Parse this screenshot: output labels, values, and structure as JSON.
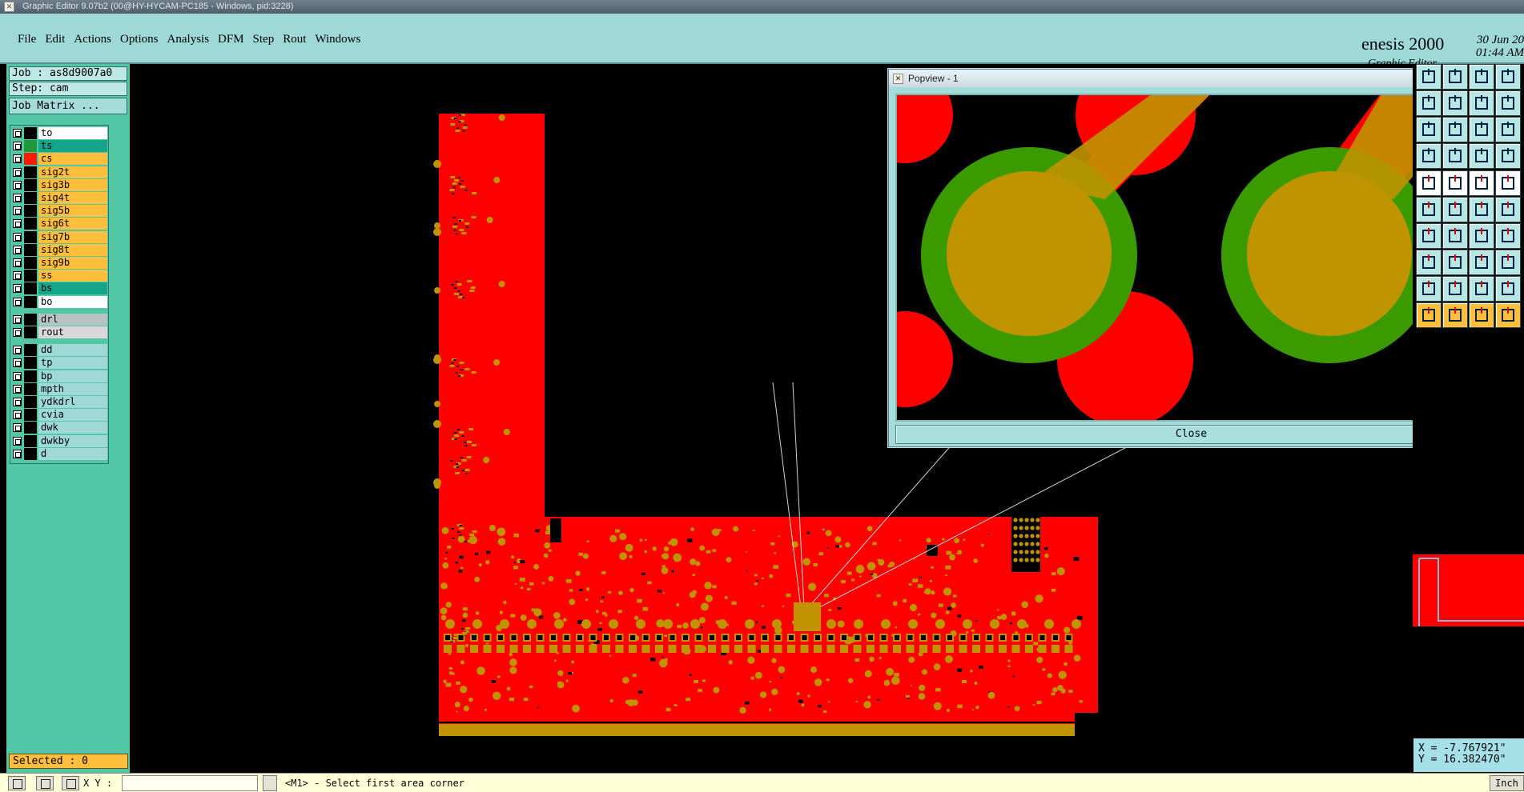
{
  "window": {
    "title": "Graphic Editor 9.07b2 (00@HY-HYCAM-PC185 - Windows, pid:3228)"
  },
  "menu": {
    "items": [
      "File",
      "Edit",
      "Actions",
      "Options",
      "Analysis",
      "DFM",
      "Step",
      "Rout",
      "Windows"
    ]
  },
  "brand": {
    "name": "enesis 2000",
    "subtitle": "Graphic Editor",
    "date": "30 Jun 20",
    "time": "01:44 AM"
  },
  "job": {
    "label": "Job : as8d9007a0",
    "step": "Step: cam",
    "matrix_button": "Job Matrix ..."
  },
  "layers": [
    {
      "name": "to",
      "swatch": "#000000",
      "bg": "#ffffff"
    },
    {
      "name": "ts",
      "swatch": "#1f9a3a",
      "bg": "#15a58b"
    },
    {
      "name": "cs",
      "swatch": "#ff1a00",
      "bg": "#ffbf3c"
    },
    {
      "name": "sig2t",
      "swatch": "#000000",
      "bg": "#ffbf3c"
    },
    {
      "name": "sig3b",
      "swatch": "#000000",
      "bg": "#ffbf3c"
    },
    {
      "name": "sig4t",
      "swatch": "#000000",
      "bg": "#ffbf3c"
    },
    {
      "name": "sig5b",
      "swatch": "#000000",
      "bg": "#ffbf3c"
    },
    {
      "name": "sig6t",
      "swatch": "#000000",
      "bg": "#ffbf3c"
    },
    {
      "name": "sig7b",
      "swatch": "#000000",
      "bg": "#ffbf3c"
    },
    {
      "name": "sig8t",
      "swatch": "#000000",
      "bg": "#ffbf3c"
    },
    {
      "name": "sig9b",
      "swatch": "#000000",
      "bg": "#ffbf3c"
    },
    {
      "name": "ss",
      "swatch": "#000000",
      "bg": "#ffbf3c"
    },
    {
      "name": "bs",
      "swatch": "#000000",
      "bg": "#15a58b"
    },
    {
      "name": "bo",
      "swatch": "#000000",
      "bg": "#ffffff"
    },
    {
      "name": "drl",
      "swatch": "#000000",
      "bg": "#b7c3c2"
    },
    {
      "name": "rout",
      "swatch": "#000000",
      "bg": "#d8d8d8"
    },
    {
      "name": "dd",
      "swatch": "#000000",
      "bg": "#9ed9d8"
    },
    {
      "name": "tp",
      "swatch": "#000000",
      "bg": "#9ed9d8"
    },
    {
      "name": "bp",
      "swatch": "#000000",
      "bg": "#9ed9d8"
    },
    {
      "name": "mpth",
      "swatch": "#000000",
      "bg": "#9ed9d8"
    },
    {
      "name": "ydkdrl",
      "swatch": "#000000",
      "bg": "#9ed9d8"
    },
    {
      "name": "cvia",
      "swatch": "#000000",
      "bg": "#9ed9d8"
    },
    {
      "name": "dwk",
      "swatch": "#000000",
      "bg": "#9ed9d8"
    },
    {
      "name": "dwkby",
      "swatch": "#000000",
      "bg": "#9ed9d8"
    },
    {
      "name": "d",
      "swatch": "#000000",
      "bg": "#9ed9d8"
    }
  ],
  "selected": "Selected : 0",
  "popview": {
    "title": "Popview - 1",
    "close_label": "Close",
    "close_x": "X"
  },
  "coords": {
    "x": "X = -7.767921\"",
    "y": "Y = 16.382470\""
  },
  "status": {
    "xy_label": "X Y :",
    "xy_value": "",
    "message": "<M1> - Select first area corner",
    "units": "Inch"
  },
  "colors": {
    "copper": "#ff0000",
    "pad": "#c09400",
    "soldermask": "#3a9a00",
    "panel": "#51c7a5",
    "menubar": "#9ed9d8"
  }
}
